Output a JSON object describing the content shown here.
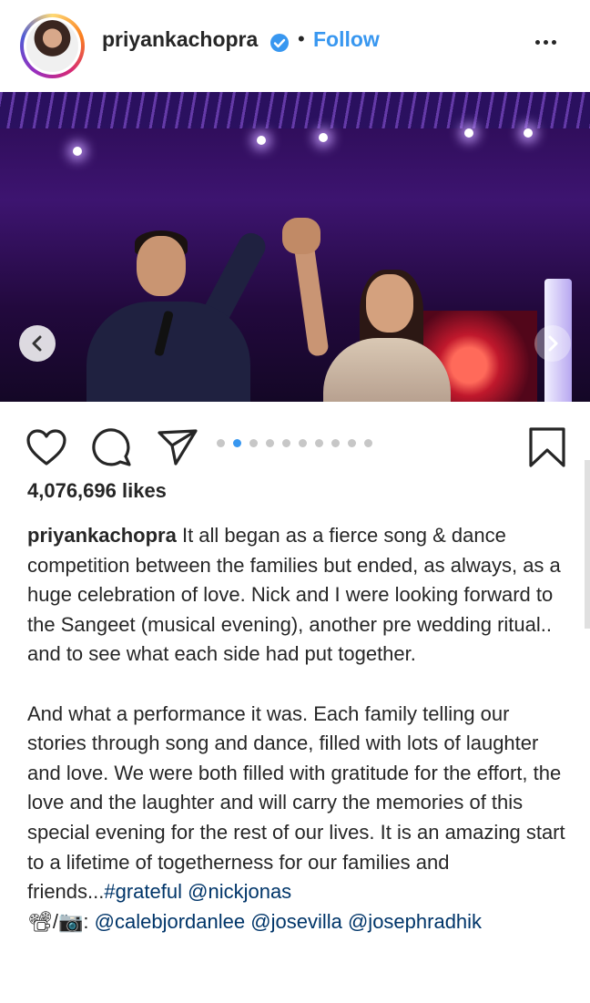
{
  "header": {
    "username": "priyankachopra",
    "separator": "•",
    "follow_label": "Follow"
  },
  "post": {
    "carousel": {
      "total_images": 10,
      "active_index": 2
    },
    "likes": "4,076,696 likes"
  },
  "caption": {
    "username": "priyankachopra",
    "paragraph1": "It all began as a fierce song & dance competition between the families but ended, as always, as a huge celebration of love.  Nick and I were looking forward to the Sangeet (musical evening), another pre wedding ritual.. and to see what each side had put together.",
    "paragraph2": "And what a performance it was. Each family telling our stories through song and dance, filled with lots of laughter and love. We were both filled with gratitude for the effort, the love and the laughter and will carry the memories of this special evening for the rest of our lives. It is an amazing start to a lifetime of togetherness for our families and friends...",
    "hashtag": "#grateful",
    "mention": "@nickjonas",
    "credits_prefix": "📽/📷: ",
    "credits": [
      "@calebjordanlee",
      "@josevilla",
      "@josephradhik"
    ]
  },
  "icons": {
    "verified": "verified-badge-icon",
    "more": "more-options-icon",
    "like": "heart-icon",
    "comment": "comment-icon",
    "share": "send-icon",
    "save": "bookmark-icon",
    "prev": "chevron-left-icon",
    "next": "chevron-right-icon"
  },
  "colors": {
    "link": "#003569",
    "follow": "#3897f0",
    "active_dot": "#3897f0"
  }
}
